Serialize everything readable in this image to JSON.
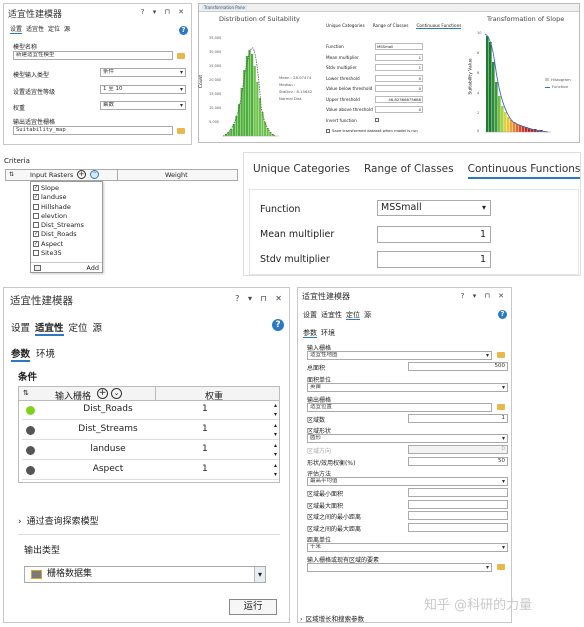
{
  "tl": {
    "title": "适宜性建模器",
    "tabs": [
      "设置",
      "适宜性",
      "定位",
      "源"
    ],
    "model_name_label": "模型名称",
    "model_name_value": "新建适宜性模型",
    "model_input_type_label": "模型输入类型",
    "model_input_type_value": "条件",
    "scale_label": "设置适宜性等级",
    "scale_value": "1 至 10",
    "weight_label": "权重",
    "weight_value": "乘数",
    "output_label": "输出适宜性栅格",
    "output_value": "Suitability_map"
  },
  "tr": {
    "window_title": "Transformation Pane",
    "left_title": "Distribution of Suitability",
    "right_title": "Transformation of Slope",
    "count_label": "Count",
    "sv_label": "Suitability Value",
    "left_yticks": [
      "35,000",
      "30,000",
      "25,000",
      "20,000",
      "15,000",
      "10,000",
      "5,000",
      "0"
    ],
    "right_yticks": [
      "10",
      "8",
      "6",
      "4",
      "2",
      "0"
    ],
    "legend_left": [
      "Mean : 28.07474",
      "Median :",
      "StdDev : 8.15642",
      "Normal Dist."
    ],
    "legend_right": [
      "Histogram",
      "Function"
    ],
    "tabs": [
      "Unique Categories",
      "Range of Classes",
      "Continuous Functions"
    ],
    "fields": [
      {
        "label": "Function",
        "value": "MSSmall"
      },
      {
        "label": "Mean multiplier",
        "value": "1"
      },
      {
        "label": "Stdv multiplier",
        "value": "1"
      },
      {
        "label": "Lower threshold",
        "value": "0"
      },
      {
        "label": "Value below threshold",
        "value": "0"
      },
      {
        "label": "Upper threshold",
        "value": "46.82366875686"
      },
      {
        "label": "Value above threshold",
        "value": "0"
      },
      {
        "label": "Invert function",
        "value": ""
      }
    ],
    "save_label": "Save transformed dataset when model is run"
  },
  "crit": {
    "title": "Criteria",
    "col_input": "Input Rasters",
    "col_weight": "Weight",
    "items": [
      {
        "name": "Slope",
        "checked": "✓"
      },
      {
        "name": "landuse",
        "checked": "✓"
      },
      {
        "name": "Hillshade",
        "checked": ""
      },
      {
        "name": "elevtion",
        "checked": ""
      },
      {
        "name": "Dist_Streams",
        "checked": ""
      },
      {
        "name": "Dist_Roads",
        "checked": "✓"
      },
      {
        "name": "Aspect",
        "checked": "✓"
      },
      {
        "name": "Site35",
        "checked": ""
      }
    ],
    "add": "Add"
  },
  "cf": {
    "tabs": [
      "Unique Categories",
      "Range of Classes",
      "Continuous Functions"
    ],
    "function_label": "Function",
    "function_value": "MSSmall",
    "mean_label": "Mean multiplier",
    "mean_value": "1",
    "stdv_label": "Stdv multiplier",
    "stdv_value": "1"
  },
  "bl": {
    "title": "适宜性建模器",
    "tabs": [
      "设置",
      "适宜性",
      "定位",
      "源"
    ],
    "subtabs": [
      "参数",
      "环境"
    ],
    "conditions": "条件",
    "col_input": "输入栅格",
    "col_weight": "权重",
    "rows": [
      {
        "name": "Dist_Roads",
        "weight": "1",
        "color": "#7fd21a"
      },
      {
        "name": "Dist_Streams",
        "weight": "1",
        "color": "#555555"
      },
      {
        "name": "landuse",
        "weight": "1",
        "color": "#555555"
      },
      {
        "name": "Aspect",
        "weight": "1",
        "color": "#555555"
      }
    ],
    "explore": "通过查询探索模型",
    "output_type": "输出类型",
    "output_value": "栅格数据集",
    "run": "运行"
  },
  "br": {
    "title": "适宜性建模器",
    "tabs": [
      "设置",
      "适宜性",
      "定位",
      "源"
    ],
    "subtabs": [
      "参数",
      "环境"
    ],
    "fields": [
      {
        "label": "输入栅格",
        "value": "适宜性地图",
        "kind": "dd-folder"
      },
      {
        "label": "总面积",
        "value": "500",
        "kind": "num"
      },
      {
        "label": "面积单位",
        "value": "英亩",
        "kind": "dd"
      },
      {
        "label": "输出栅格",
        "value": "适宜位置",
        "kind": "folder"
      },
      {
        "label": "区域数",
        "value": "1",
        "kind": "num"
      },
      {
        "label": "区域形状",
        "value": "圆形",
        "kind": "dd"
      },
      {
        "label": "区域方向",
        "value": "0",
        "kind": "num-dis"
      },
      {
        "label": "形状/效用权衡(%)",
        "value": "50",
        "kind": "num"
      },
      {
        "label": "评估方法",
        "value": "最高平均值",
        "kind": "dd"
      },
      {
        "label": "区域最小面积",
        "value": "",
        "kind": "text"
      },
      {
        "label": "区域最大面积",
        "value": "",
        "kind": "text"
      },
      {
        "label": "区域之间的最小距离",
        "value": "",
        "kind": "text"
      },
      {
        "label": "区域之间的最大距离",
        "value": "",
        "kind": "text"
      },
      {
        "label": "距离单位",
        "value": "千米",
        "kind": "dd"
      },
      {
        "label": "输入栅格或现有区域的要素",
        "value": "",
        "kind": "dd-folder"
      }
    ],
    "footer": "区域增长和搜索参数"
  },
  "watermark": "知乎 @科研的力量"
}
